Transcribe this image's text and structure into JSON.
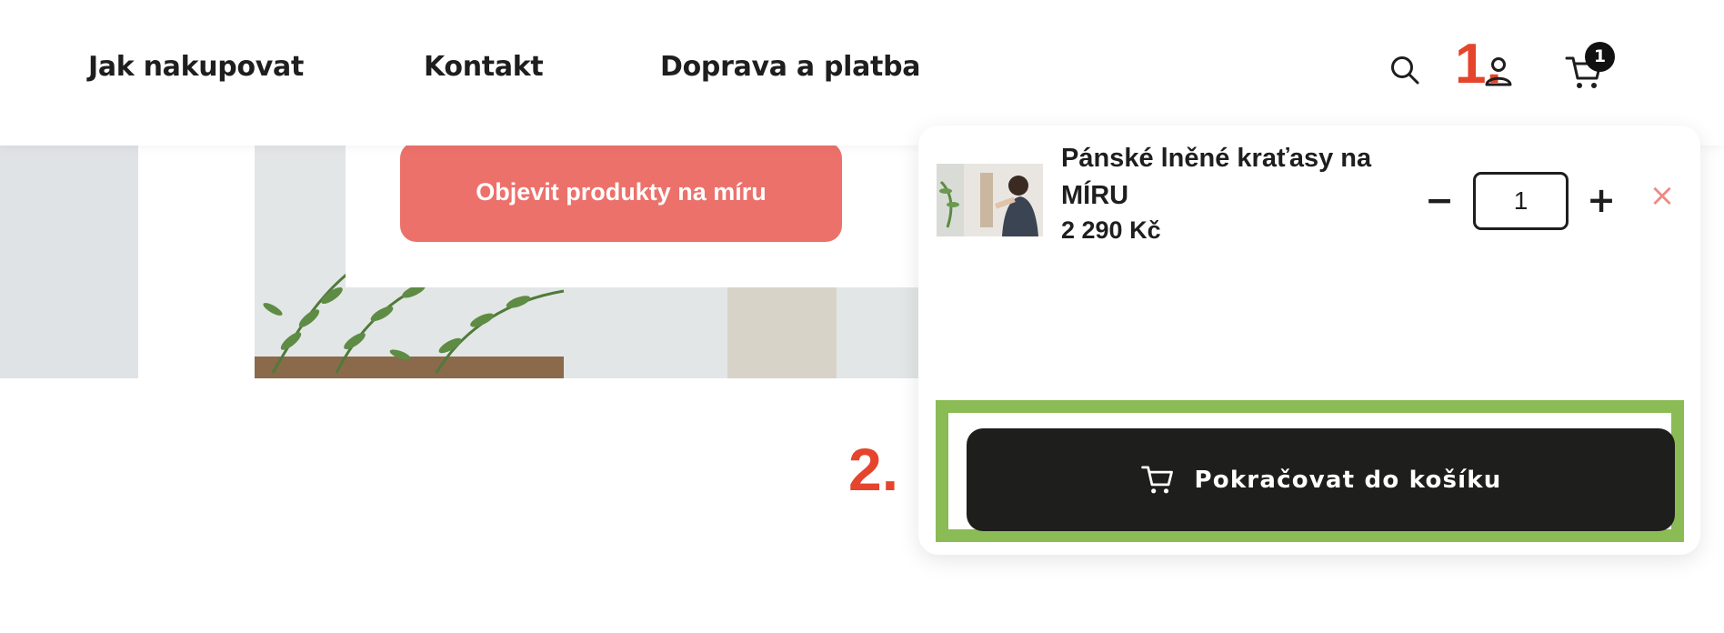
{
  "nav": {
    "links": [
      "Jak nakupovat",
      "Kontakt",
      "Doprava a platba"
    ]
  },
  "header_icons": {
    "search": "search-icon",
    "account": "user-icon",
    "cart": "cart-icon",
    "cart_count": "1"
  },
  "annotations": {
    "step1": "1.",
    "step2": "2."
  },
  "hero": {
    "promo_button": "Objevit produkty na míru"
  },
  "mini_cart": {
    "item": {
      "name": "Pánské lněné kraťasy na MÍRU",
      "price": "2 290 Kč",
      "quantity": "1"
    },
    "decrement_label": "−",
    "increment_label": "+",
    "remove_label": "×",
    "checkout_label": "Pokračovat do košíku"
  },
  "colors": {
    "accent_green": "#8bbb55",
    "promo_coral": "#ec716b",
    "annotation_red": "#e5452c",
    "remove_pink": "#ee8a85",
    "dark_button": "#1e1e1c"
  }
}
